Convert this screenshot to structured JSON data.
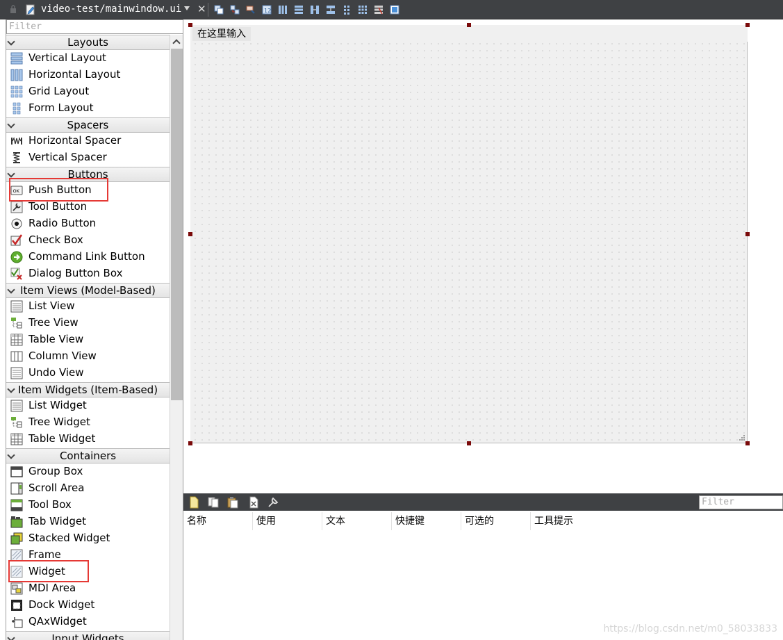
{
  "topbar": {
    "filename": "video-test/mainwindow.ui"
  },
  "widget_box": {
    "filter_placeholder": "Filter",
    "categories": [
      {
        "label": "Layouts",
        "items": [
          "Vertical Layout",
          "Horizontal Layout",
          "Grid Layout",
          "Form Layout"
        ]
      },
      {
        "label": "Spacers",
        "items": [
          "Horizontal Spacer",
          "Vertical Spacer"
        ]
      },
      {
        "label": "Buttons",
        "items": [
          "Push Button",
          "Tool Button",
          "Radio Button",
          "Check Box",
          "Command Link Button",
          "Dialog Button Box"
        ]
      },
      {
        "label": "Item Views (Model-Based)",
        "items": [
          "List View",
          "Tree View",
          "Table View",
          "Column View",
          "Undo View"
        ]
      },
      {
        "label": "Item Widgets (Item-Based)",
        "items": [
          "List Widget",
          "Tree Widget",
          "Table Widget"
        ]
      },
      {
        "label": "Containers",
        "items": [
          "Group Box",
          "Scroll Area",
          "Tool Box",
          "Tab Widget",
          "Stacked Widget",
          "Frame",
          "Widget",
          "MDI Area",
          "Dock Widget",
          "QAxWidget"
        ]
      },
      {
        "label": "Input Widgets",
        "items": []
      }
    ]
  },
  "form": {
    "menu_placeholder": "在这里输入"
  },
  "action_editor": {
    "filter_placeholder": "Filter",
    "columns": [
      "名称",
      "使用",
      "文本",
      "快捷键",
      "可选的",
      "工具提示"
    ]
  },
  "watermark": "https://blog.csdn.net/m0_58033833",
  "colors": {
    "toolbar_bg": "#3f4144",
    "highlight": "#e53935",
    "handle": "#7a0a0a"
  }
}
